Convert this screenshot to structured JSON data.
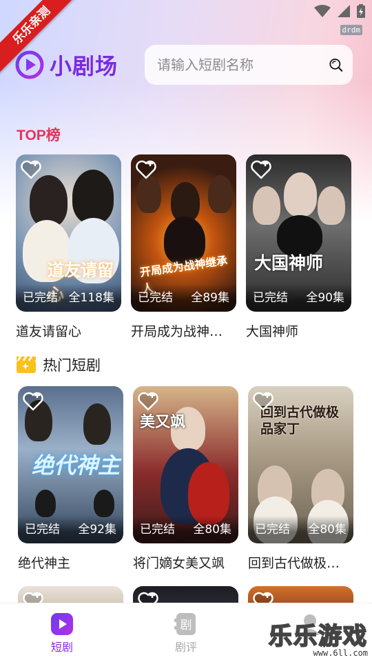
{
  "ribbon": "乐乐亲测",
  "status": {
    "debug_tag": "drdm"
  },
  "header": {
    "logo_text": "小剧场",
    "search_placeholder": "请输入短剧名称"
  },
  "top_section": {
    "title": "TOP榜",
    "items": [
      {
        "status": "已完结",
        "episodes": "全118集",
        "title": "道友请留心",
        "poster_text": "道友请留心"
      },
      {
        "status": "已完结",
        "episodes": "全89集",
        "title": "开局成为战神…",
        "poster_text": "开局成为战神继承人"
      },
      {
        "status": "已完结",
        "episodes": "全90集",
        "title": "大国神师",
        "poster_text": "大国神师"
      }
    ]
  },
  "hot_section": {
    "title": "热门短剧",
    "items": [
      {
        "status": "已完结",
        "episodes": "全92集",
        "title": "绝代神主",
        "poster_text": "绝代神主"
      },
      {
        "status": "已完结",
        "episodes": "全80集",
        "title": "将门嫡女美又飒",
        "poster_text": "美又飒"
      },
      {
        "status": "已完结",
        "episodes": "全80集",
        "title": "回到古代做极…",
        "poster_text": "回到古代做极品家丁"
      }
    ]
  },
  "bottom_nav": {
    "items": [
      {
        "label": "短剧",
        "active": true,
        "icon": "play-icon"
      },
      {
        "label": "剧评",
        "active": false,
        "icon": "drama-review-icon"
      },
      {
        "label": "",
        "active": false,
        "icon": "profile-icon"
      }
    ]
  },
  "watermark": {
    "big": "乐乐游戏",
    "small": "www.6ll.com"
  },
  "colors": {
    "accent": "#7a2ae2",
    "top_title": "#e8325a",
    "nav_active": "#8a2be2"
  }
}
